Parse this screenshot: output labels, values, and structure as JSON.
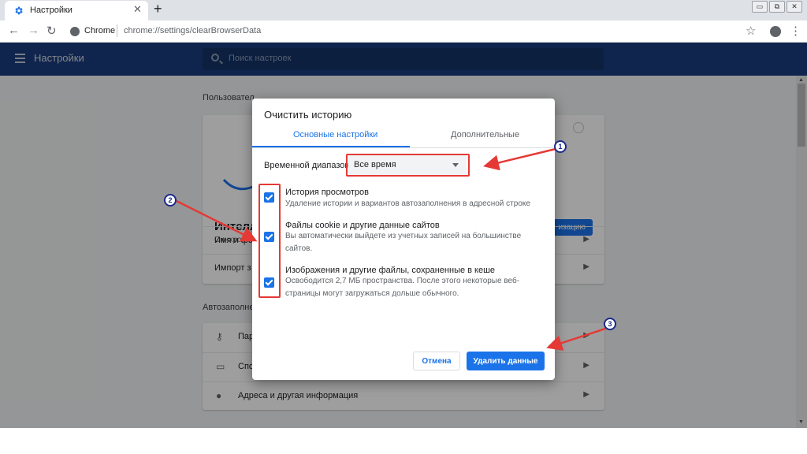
{
  "browser": {
    "tab_title": "Настройки",
    "tab_close": "✕",
    "new_tab": "+",
    "omnibox_label": "Chrome",
    "url": "chrome://settings/clearBrowserData",
    "window_buttons": [
      "▭",
      "⧉",
      "✕"
    ]
  },
  "header": {
    "title": "Настройки",
    "search_placeholder": "Поиск настроек"
  },
  "page": {
    "section_users": "Пользовател",
    "user_name": "Интелле",
    "user_sync": "Синхрониз",
    "sync_button": "изацию",
    "row_name_photo": "Имя и фото",
    "row_import": "Импорт з",
    "section_autofill": "Автозаполнен",
    "row_passwords": "Пар",
    "row_payment": "Спо",
    "row_addresses": "Адреса и другая информация"
  },
  "dialog": {
    "title": "Очистить историю",
    "tab_basic": "Основные настройки",
    "tab_advanced": "Дополнительные",
    "range_label": "Временной диапазон",
    "range_value": "Все время",
    "items": [
      {
        "title": "История просмотров",
        "desc": "Удаление истории и вариантов автозаполнения в адресной строке",
        "checked": true
      },
      {
        "title": "Файлы cookie и другие данные сайтов",
        "desc": "Вы автоматически выйдете из учетных записей на большинстве сайтов.",
        "checked": true
      },
      {
        "title": "Изображения и другие файлы, сохраненные в кеше",
        "desc": "Освободится 2,7 МБ пространства. После этого некоторые веб-страницы могут загружаться дольше обычного.",
        "checked": true
      }
    ],
    "cancel": "Отмена",
    "delete": "Удалить данные"
  },
  "annotations": {
    "badges": [
      "1",
      "2",
      "3"
    ],
    "color": "#e53935"
  },
  "colors": {
    "accent": "#1a73e8",
    "header_bg": "#1a3d7c"
  }
}
